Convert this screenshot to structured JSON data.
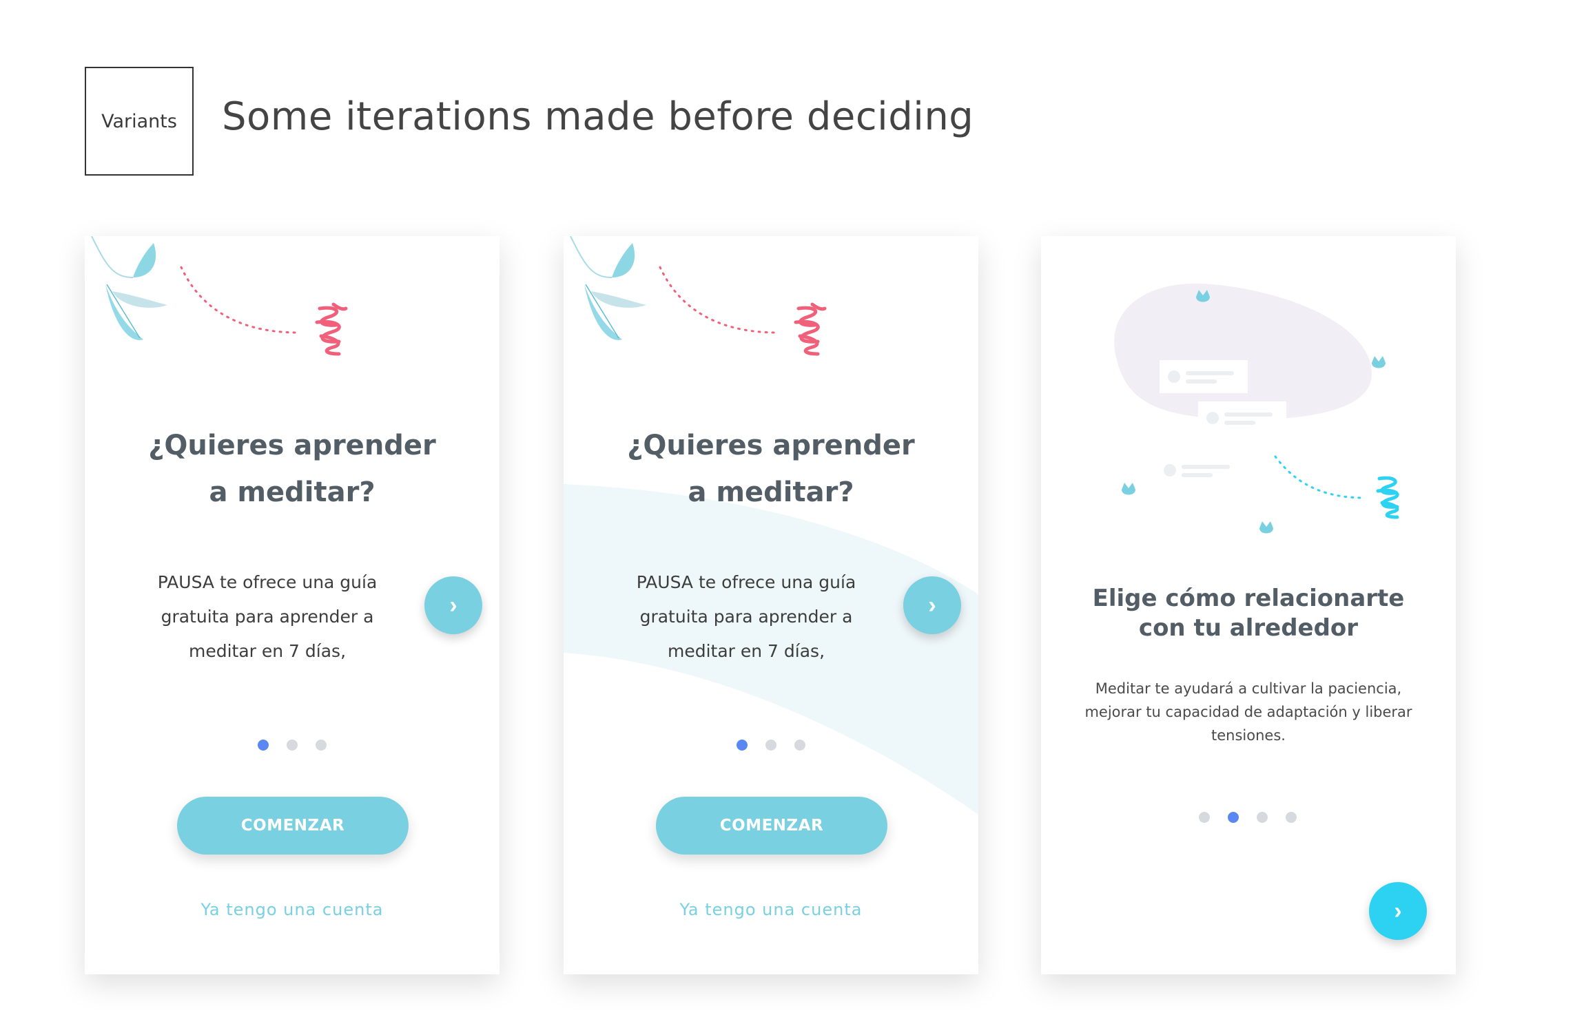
{
  "header": {
    "variants_label": "Variants",
    "headline": "Some iterations made before deciding"
  },
  "colors": {
    "accent": "#79d0e1",
    "accent_bright": "#2dd2f2",
    "logo_pink": "#f0607a",
    "dot_active": "#5b87f2",
    "dot_inactive": "#d6d9de",
    "title_text": "#525d66"
  },
  "cards": [
    {
      "title_line1": "¿Quieres aprender",
      "title_line2": "a meditar?",
      "body_line1": "PAUSA te ofrece una guía",
      "body_line2": "gratuita para aprender a",
      "body_line3": "meditar en 7 días,",
      "next_icon": "›",
      "cta_label": "COMENZAR",
      "link_label": "Ya tengo una cuenta",
      "pagination": {
        "active": 1,
        "total": 3
      }
    },
    {
      "title_line1": "¿Quieres aprender",
      "title_line2": "a meditar?",
      "body_line1": "PAUSA te ofrece una guía",
      "body_line2": "gratuita para aprender a",
      "body_line3": "meditar en 7 días,",
      "next_icon": "›",
      "cta_label": "COMENZAR",
      "link_label": "Ya tengo una cuenta",
      "pagination": {
        "active": 1,
        "total": 3
      }
    },
    {
      "title_line1": "Elige cómo relacionarte",
      "title_line2": "con tu alrededor",
      "body_line1": "Meditar te ayudará a cultivar la paciencia,",
      "body_line2": "mejorar tu capacidad de adaptación y liberar",
      "body_line3": "tensiones.",
      "next_icon": "›",
      "pagination": {
        "active": 2,
        "total": 4
      }
    }
  ],
  "icons": [
    "leaves-icon",
    "pausa-logo-icon",
    "tulip-icon",
    "chevron-right-icon"
  ]
}
